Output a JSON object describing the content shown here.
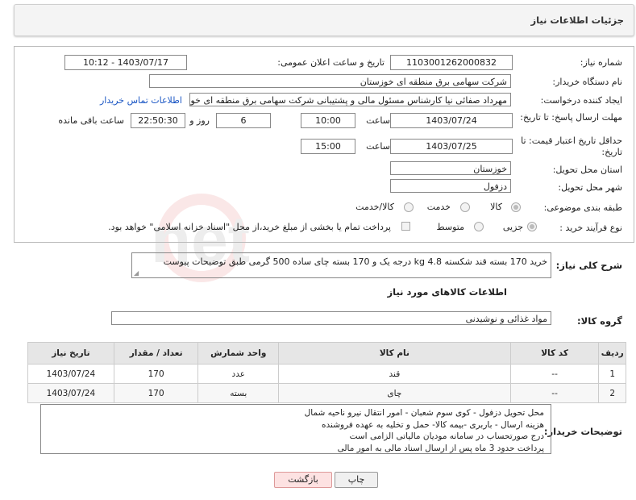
{
  "header": {
    "title": "جزئیات اطلاعات نیاز"
  },
  "form": {
    "need_number_label": "شماره نیاز:",
    "need_number": "1103001262000832",
    "announce_label": "تاریخ و ساعت اعلان عمومی:",
    "announce_value": "1403/07/17 - 10:12",
    "buyer_org_label": "نام دستگاه خریدار:",
    "buyer_org": "شرکت سهامی برق منطقه ای خوزستان",
    "creator_label": "ایجاد کننده درخواست:",
    "creator": "مهرداد صفائی نیا کارشناس مسئول مالی و پشتیبانی شرکت سهامی برق منطقه ای خوزستان",
    "contact_link": "اطلاعات تماس خریدار",
    "reply_deadline_label": "مهلت ارسال پاسخ: تا تاریخ:",
    "reply_date": "1403/07/24",
    "time_label": "ساعت",
    "reply_time": "10:00",
    "days_value": "6",
    "days_label": "روز و",
    "remaining_time": "22:50:30",
    "remaining_label": "ساعت باقی مانده",
    "price_deadline_label": "حداقل تاریخ اعتبار قیمت: تا تاریخ:",
    "price_date": "1403/07/25",
    "price_time": "15:00",
    "province_label": "استان محل تحویل:",
    "province": "خوزستان",
    "city_label": "شهر محل تحویل:",
    "city": "دزفول",
    "category_label": "طبقه بندی موضوعی:",
    "category_options": [
      "کالا",
      "خدمت",
      "کالا/خدمت"
    ],
    "purchase_type_label": "نوع فرآیند خرید :",
    "purchase_options": [
      "جزیی",
      "متوسط"
    ],
    "payment_note": "پرداخت تمام یا بخشی از مبلغ خرید،از محل \"اسناد خزانه اسلامی\" خواهد بود."
  },
  "summary": {
    "label": "شرح کلی نیاز:",
    "text": "خرید 170 بسته قند شکسته 4.8 kg  درجه یک و 170 بسته چای ساده 500 گرمی طبق توضیحات پیوست"
  },
  "goods": {
    "section_title": "اطلاعات کالاهای مورد نیاز",
    "group_label": "گروه کالا:",
    "group_value": "مواد غذائی و نوشیدنی",
    "columns": [
      "ردیف",
      "کد کالا",
      "نام کالا",
      "واحد شمارش",
      "تعداد / مقدار",
      "تاریخ نیاز"
    ],
    "rows": [
      [
        "1",
        "--",
        "قند",
        "عدد",
        "170",
        "1403/07/24"
      ],
      [
        "2",
        "--",
        "چای",
        "بسته",
        "170",
        "1403/07/24"
      ]
    ]
  },
  "buyer_notes": {
    "label": "توضیحات خریدار:",
    "lines": [
      "محل تحویل دزفول - کوی سوم شعبان - امور انتقال نیرو ناحیه شمال",
      "هزینه ارسال - باربری -بیمه کالا- حمل و تخلیه به عهده فروشنده",
      "درج صورتحساب در سامانه مودیان مالیاتی الزامی است",
      "پرداخت حدود 3 ماه پس از ارسال اسناد مالی به  امور مالی"
    ]
  },
  "buttons": {
    "print": "چاپ",
    "back": "بازگشت"
  },
  "colors": {
    "link": "#1a56c4",
    "back_button": "#fde2e2",
    "print_button": "#f0f0f0"
  }
}
